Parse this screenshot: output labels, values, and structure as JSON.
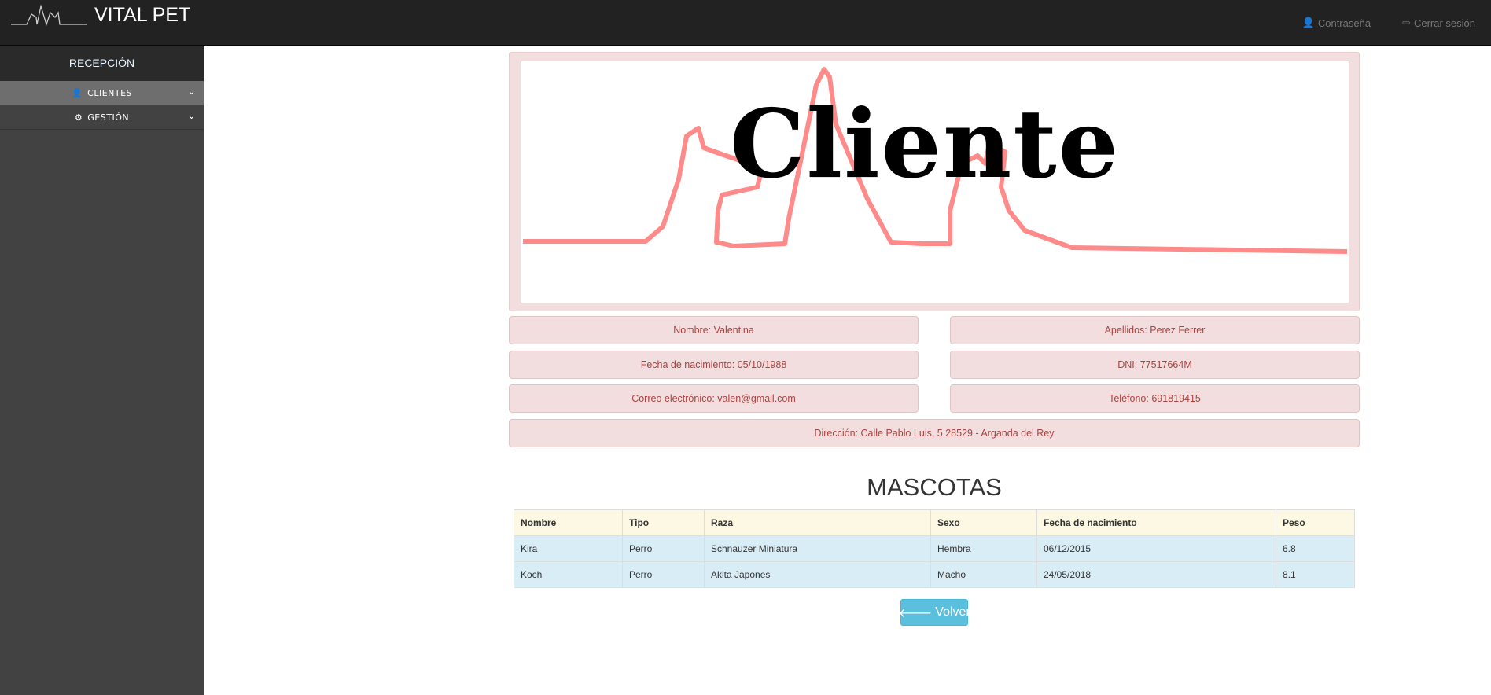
{
  "header": {
    "brand": "VITAL PET",
    "links": [
      {
        "label": "Contraseña",
        "icon": "user-icon"
      },
      {
        "label": "Cerrar sesión",
        "icon": "logout-icon"
      }
    ]
  },
  "sidebar": {
    "title": "RECEPCIÓN",
    "items": [
      {
        "label": "CLIENTES",
        "icon": "user-icon"
      },
      {
        "label": "GESTIÓN",
        "icon": "gear-icon"
      }
    ]
  },
  "banner": {
    "text": "Cliente"
  },
  "client": {
    "nombre": "Nombre: Valentina",
    "apellidos": "Apellidos: Perez Ferrer",
    "fecha": "Fecha de nacimiento: 05/10/1988",
    "dni": "DNI: 77517664M",
    "correo": "Correo electrónico: valen@gmail.com",
    "telefono": "Teléfono: 691819415",
    "direccion": "Dirección: Calle Pablo Luis, 5 28529 - Arganda del Rey"
  },
  "pets": {
    "title": "MASCOTAS",
    "columns": [
      "Nombre",
      "Tipo",
      "Raza",
      "Sexo",
      "Fecha de nacimiento",
      "Peso"
    ],
    "rows": [
      [
        "Kira",
        "Perro",
        "Schnauzer Miniatura",
        "Hembra",
        "06/12/2015",
        "6.8"
      ],
      [
        "Koch",
        "Perro",
        "Akita Japones",
        "Macho",
        "24/05/2018",
        "8.1"
      ]
    ]
  },
  "actions": {
    "back": "Volver"
  },
  "colors": {
    "accent": "#5bc0de",
    "panel": "#f2dede",
    "panel_text": "#a94442"
  }
}
